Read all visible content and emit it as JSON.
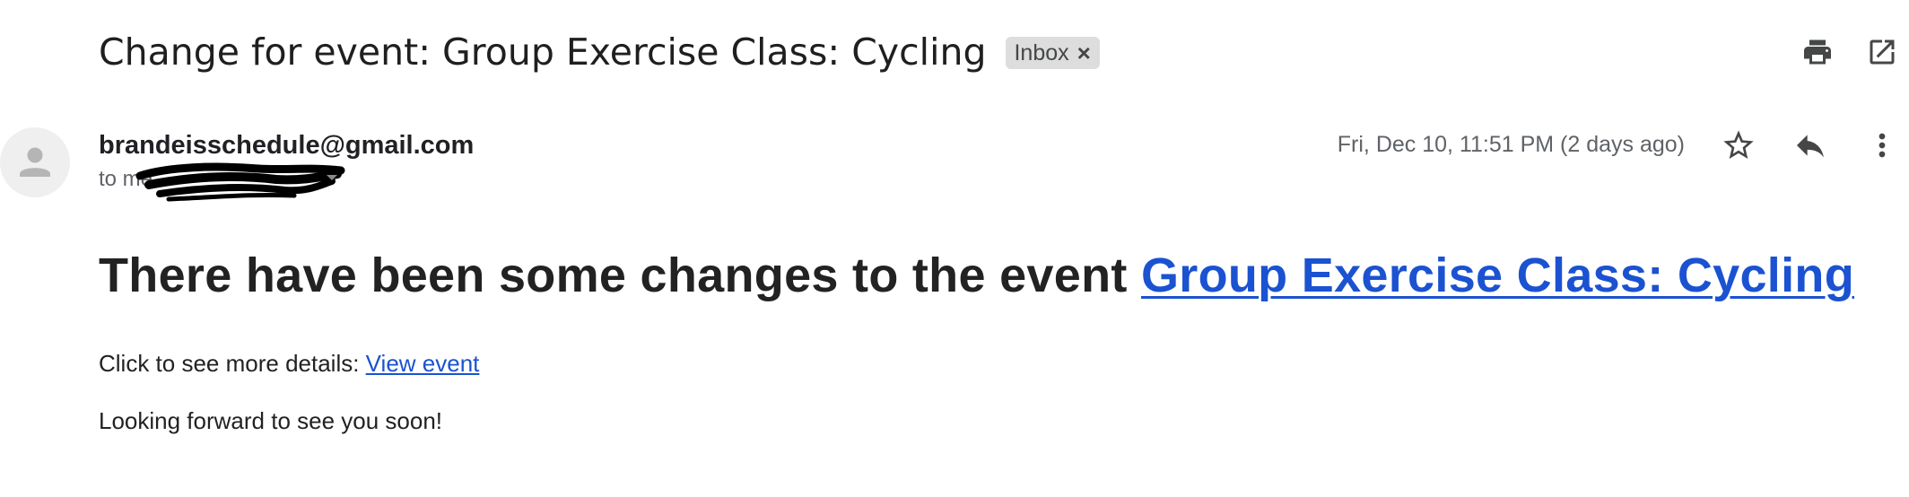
{
  "email": {
    "subject": "Change for event: Group Exercise Class: Cycling",
    "label": "Inbox",
    "label_remove_glyph": "×",
    "sender": "brandeisschedule@gmail.com",
    "recipient_prefix": "to me",
    "timestamp": "Fri, Dec 10, 11:51 PM (2 days ago)"
  },
  "body": {
    "heading_text": "There have been some changes to the event ",
    "heading_link": "Group Exercise Class: Cycling",
    "details_text": "Click to see more details: ",
    "details_link": "View event",
    "closing": "Looking forward to see you soon!"
  },
  "icons": {
    "print": "print-icon",
    "open_new_window": "open-in-new-window-icon",
    "star": "star-icon",
    "reply": "reply-icon",
    "more": "more-vert-icon",
    "avatar": "avatar-placeholder-icon"
  },
  "colors": {
    "link": "#1a52d1",
    "muted_text": "#5f6368",
    "chip_bg": "#dddddd"
  }
}
